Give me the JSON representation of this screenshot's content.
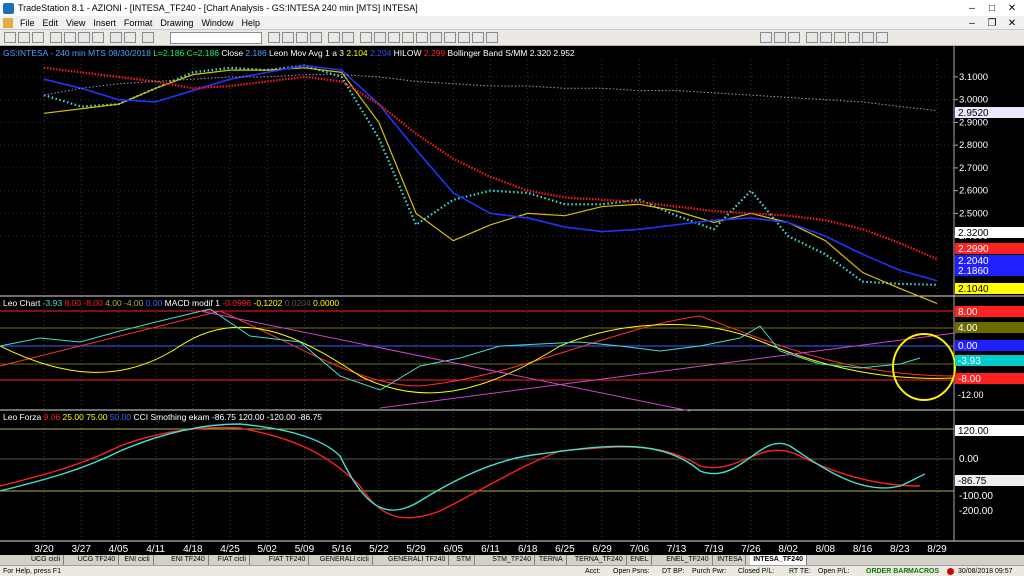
{
  "window": {
    "title": "TradeStation 8.1 - AZIONI - [INTESA_TF240 - [Chart Analysis - GS:INTESA  240 min  [MTS] INTESA]"
  },
  "menu": [
    "File",
    "Edit",
    "View",
    "Insert",
    "Format",
    "Drawing",
    "Window",
    "Help"
  ],
  "price_panel": {
    "header": [
      {
        "text": "GS:INTESA - 240 min   MTS   08/30/2018",
        "color": "#4aa0ff"
      },
      {
        "text": "L=2.186  C=2.186",
        "color": "#00ff66"
      },
      {
        "text": "Close",
        "color": "#ffffff"
      },
      {
        "text": "2.186",
        "color": "#4aa0ff"
      },
      {
        "text": "Leon Mov Avg 1 a 3",
        "color": "#ffffff"
      },
      {
        "text": "2.104",
        "color": "#ffff00"
      },
      {
        "text": "2.204",
        "color": "#3355ff"
      },
      {
        "text": "HILOW",
        "color": "#ffffff"
      },
      {
        "text": "2.299",
        "color": "#ff2020"
      },
      {
        "text": "Bollinger Band S/MM",
        "color": "#ffffff"
      },
      {
        "text": "2.320",
        "color": "#ffffff"
      },
      {
        "text": "2.952",
        "color": "#ffffff"
      }
    ],
    "axis": [
      "3.1000",
      "3.0000",
      "2.9000",
      "2.8000",
      "2.7000",
      "2.6000",
      "2.5000",
      "2.4000"
    ],
    "badges": [
      {
        "text": "2.9520",
        "bg": "#e8e8ff",
        "fg": "#000000"
      },
      {
        "text": "2.3200",
        "bg": "#ffffff",
        "fg": "#000000"
      },
      {
        "text": "2.2990",
        "bg": "#ff2020",
        "fg": "#ffffff"
      },
      {
        "text": "2.2040",
        "bg": "#2020ff",
        "fg": "#ffffff"
      },
      {
        "text": "2.1860",
        "bg": "#2020ff",
        "fg": "#ffffff"
      },
      {
        "text": "2.1040",
        "bg": "#ffff00",
        "fg": "#000000"
      }
    ]
  },
  "leo_panel": {
    "header": [
      {
        "text": "Leo Chart",
        "color": "#ffffff"
      },
      {
        "text": "-3.93",
        "color": "#40e0d0"
      },
      {
        "text": "8.00",
        "color": "#ff2020"
      },
      {
        "text": "-8.00",
        "color": "#ff2020"
      },
      {
        "text": "4.00",
        "color": "#b0b040"
      },
      {
        "text": "-4.00",
        "color": "#b0b040"
      },
      {
        "text": "0.00",
        "color": "#4060ff"
      },
      {
        "text": "MACD modif 1",
        "color": "#ffffff"
      },
      {
        "text": "-0.0996",
        "color": "#ff2020"
      },
      {
        "text": "-0.1202",
        "color": "#ffff00"
      },
      {
        "text": "0.0204",
        "color": "#555555"
      },
      {
        "text": "0.0000",
        "color": "#ffff00"
      }
    ],
    "badges": [
      {
        "text": "8.00",
        "bg": "#ff2020",
        "fg": "#ffffff"
      },
      {
        "text": "4.00",
        "bg": "#6b6b00",
        "fg": "#ffffff"
      },
      {
        "text": "0.00",
        "bg": "#2020ff",
        "fg": "#ffffff"
      },
      {
        "text": "-3.93",
        "bg": "#00cccc",
        "fg": "#ffffff"
      },
      {
        "text": "-8.00",
        "bg": "#ff2020",
        "fg": "#ffffff"
      }
    ],
    "axis_label": "-12.00"
  },
  "forza_panel": {
    "header": [
      {
        "text": "Leo Forza",
        "color": "#ffffff"
      },
      {
        "text": "9.06",
        "color": "#ff2020"
      },
      {
        "text": "25.00",
        "color": "#ffff00"
      },
      {
        "text": "75.00",
        "color": "#ffff00"
      },
      {
        "text": "50.00",
        "color": "#4060ff"
      },
      {
        "text": "CCI Smothing ekam",
        "color": "#ffffff"
      },
      {
        "text": "-86.75",
        "color": "#ffffff"
      },
      {
        "text": "120.00",
        "color": "#ffffff"
      },
      {
        "text": "-120.00",
        "color": "#ffffff"
      },
      {
        "text": "-86.75",
        "color": "#ffffff"
      }
    ],
    "axis": [
      "120.00",
      "0.00",
      "-86.75",
      "-100.00",
      "-200.00"
    ]
  },
  "x_axis": [
    "3/20",
    "3/27",
    "4/05",
    "4/11",
    "4/18",
    "4/25",
    "5/02",
    "5/09",
    "5/16",
    "5/22",
    "5/29",
    "6/05",
    "6/11",
    "6/18",
    "6/25",
    "6/29",
    "7/06",
    "7/13",
    "7/19",
    "7/26",
    "8/02",
    "8/08",
    "8/16",
    "8/23",
    "8/29"
  ],
  "tabs": [
    "UCG cicli",
    "UCG TF240",
    "ENI cicli",
    "ENI TF240",
    "FIAT cicli",
    "FIAT TF240",
    "GENERALI cicli",
    "GENERALI TF240",
    "STM",
    "STM_TF240",
    "TERNA",
    "TERNA_TF240",
    "ENEL",
    "ENEL_TF240",
    "INTESA",
    "INTESA_TF240"
  ],
  "active_tab": "INTESA_TF240",
  "status": {
    "help": "For Help, press F1",
    "acct": "Acct:",
    "open_psns": "Open Psns:",
    "dt_bp": "DT BP:",
    "purch_pwr": "Purch Pwr:",
    "closed_pl": "Closed P/L:",
    "rt_te": "RT TE:",
    "open_pl": "Open P/L:",
    "order_bar": "ORDER BAR",
    "macros": "MACROS",
    "datetime": "30/08/2018 09:57"
  },
  "chart_data": {
    "type": "line",
    "x": [
      "3/20",
      "3/27",
      "4/05",
      "4/11",
      "4/18",
      "4/25",
      "5/02",
      "5/09",
      "5/16",
      "5/22",
      "5/29",
      "6/05",
      "6/11",
      "6/18",
      "6/25",
      "6/29",
      "7/06",
      "7/13",
      "7/19",
      "7/26",
      "8/02",
      "8/08",
      "8/16",
      "8/23",
      "8/29"
    ],
    "series": [
      {
        "values": [
          3.02,
          2.97,
          2.98,
          3.05,
          3.12,
          3.14,
          3.13,
          3.15,
          3.1,
          2.83,
          2.45,
          2.56,
          2.6,
          2.59,
          2.54,
          2.54,
          2.56,
          2.49,
          2.43,
          2.6,
          2.4,
          2.32,
          2.2,
          2.19,
          2.186
        ]
      },
      {
        "values": [
          2.94,
          2.96,
          2.98,
          3.05,
          3.11,
          3.13,
          3.13,
          3.14,
          3.12,
          2.9,
          2.5,
          2.38,
          2.45,
          2.5,
          2.49,
          2.53,
          2.54,
          2.51,
          2.46,
          2.5,
          2.46,
          2.38,
          2.24,
          2.17,
          2.104
        ]
      },
      {
        "values": [
          3.09,
          3.05,
          3.0,
          2.99,
          3.04,
          3.09,
          3.12,
          3.15,
          3.13,
          2.98,
          2.78,
          2.59,
          2.5,
          2.48,
          2.44,
          2.42,
          2.43,
          2.45,
          2.47,
          2.48,
          2.46,
          2.4,
          2.32,
          2.25,
          2.204
        ]
      },
      {
        "values": [
          3.14,
          3.12,
          3.1,
          3.08,
          3.05,
          3.06,
          3.08,
          3.1,
          3.08,
          2.98,
          2.85,
          2.74,
          2.66,
          2.6,
          2.57,
          2.56,
          2.55,
          2.53,
          2.51,
          2.5,
          2.49,
          2.47,
          2.43,
          2.37,
          2.299
        ]
      },
      {
        "values": [
          3.02,
          3.05,
          3.07,
          3.08,
          3.09,
          3.1,
          3.1,
          3.11,
          3.11,
          3.1,
          3.08,
          3.07,
          3.06,
          3.06,
          3.05,
          3.05,
          3.04,
          3.04,
          3.03,
          3.02,
          3.01,
          3.0,
          2.99,
          2.97,
          2.952
        ]
      }
    ],
    "ylim": [
      2.15,
      3.17
    ]
  }
}
